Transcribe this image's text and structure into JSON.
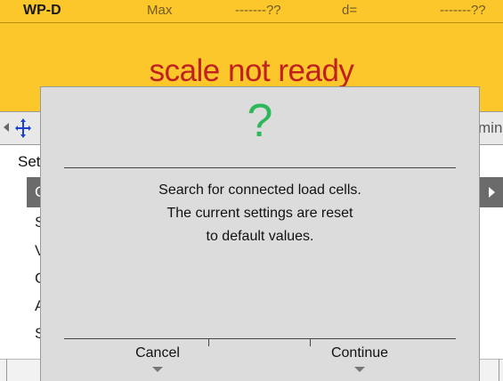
{
  "header": {
    "scale_id": "WP-D",
    "max_label": "Max",
    "max_value": "-------??",
    "d_label": "d=",
    "d_value": "-------??",
    "status_text": "scale not ready",
    "colors": {
      "background": "#fcc72b",
      "status": "#c02020"
    }
  },
  "navbar": {
    "left_icon": "arrow-left-icon",
    "move_icon": "move-icon",
    "right_text": "min"
  },
  "menu": {
    "title": "Set",
    "items": [
      {
        "label": "C",
        "selected": true
      },
      {
        "label": "S",
        "selected": false
      },
      {
        "label": "V",
        "selected": false
      },
      {
        "label": "C",
        "selected": false
      },
      {
        "label": "A",
        "selected": false
      },
      {
        "label": "S",
        "selected": false
      }
    ],
    "row_arrow_icon": "arrow-right-icon"
  },
  "dialog": {
    "icon": "question-icon",
    "icon_glyph": "?",
    "icon_color": "#2fb85a",
    "message_lines": [
      "Search for connected load cells.",
      "The current settings are reset",
      "to default values."
    ],
    "buttons": {
      "cancel": "Cancel",
      "continue": "Continue"
    }
  }
}
